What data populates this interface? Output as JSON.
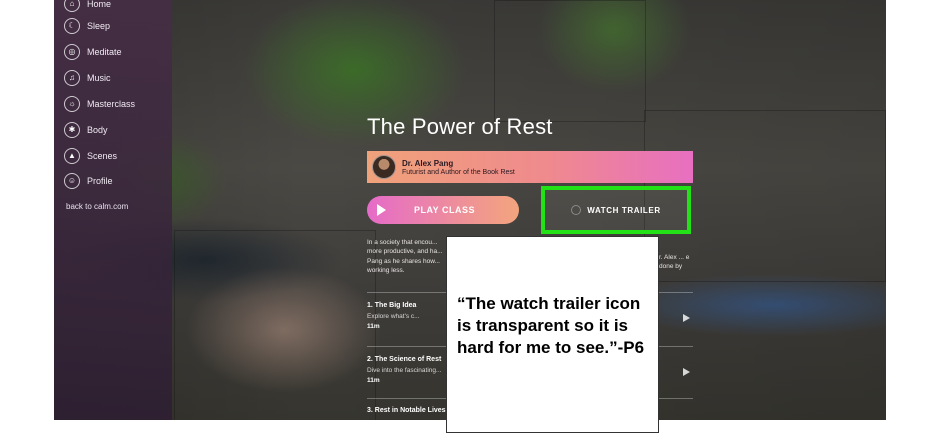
{
  "sidebar": {
    "items": [
      {
        "label": "Home",
        "icon": "home-icon",
        "glyph": "⌂"
      },
      {
        "label": "Sleep",
        "icon": "moon-icon",
        "glyph": "☾"
      },
      {
        "label": "Meditate",
        "icon": "meditate-icon",
        "glyph": "◎"
      },
      {
        "label": "Music",
        "icon": "music-icon",
        "glyph": "♫"
      },
      {
        "label": "Masterclass",
        "icon": "masterclass-icon",
        "glyph": "☼"
      },
      {
        "label": "Body",
        "icon": "body-icon",
        "glyph": "✱"
      },
      {
        "label": "Scenes",
        "icon": "scenes-icon",
        "glyph": "▲"
      },
      {
        "label": "Profile",
        "icon": "profile-icon",
        "glyph": "☺"
      }
    ],
    "back_link": "back to calm.com"
  },
  "course": {
    "title": "The Power of Rest",
    "instructor_name": "Dr. Alex Pang",
    "instructor_role": "Futurist and Author of the Book Rest",
    "play_label": "PLAY CLASS",
    "trailer_label": "WATCH TRAILER",
    "description_left": "In a society that encou... more productive, and ha... Pang as he shares how... working less.",
    "description_right": "r. Alex ... e done by"
  },
  "sessions": [
    {
      "title": "1. The Big Idea",
      "desc": "Explore what's c...",
      "duration": "11m"
    },
    {
      "title": "2. The Science of Rest",
      "desc": "Dive into the fascinating...",
      "duration": "11m"
    },
    {
      "title": "3. Rest in Notable Lives",
      "desc": "",
      "duration": ""
    }
  ],
  "annotation": {
    "text": "“The watch trailer icon is transparent so it is hard for me to see.”-P6"
  },
  "colors": {
    "highlight": "#22e116",
    "accent_pink": "#e86fc1",
    "accent_orange": "#f3a57d"
  }
}
